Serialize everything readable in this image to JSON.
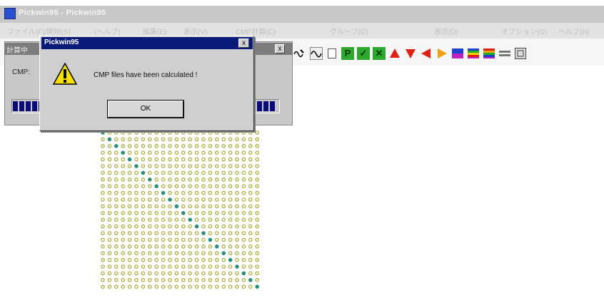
{
  "app": {
    "title": "Pickwin95 - Pickwin95",
    "menu": [
      "ファイル(F)/開始(S)",
      "(ヘルプ)",
      "編集(E)",
      "表示(V)",
      "CMP計算(C)",
      "グループ(G)",
      "表示(D)",
      "オプション(O)",
      "ヘルプ(H)"
    ]
  },
  "progress_window": {
    "title": "計算中",
    "close_label": "x",
    "label": "CMP:",
    "progress_fraction": 1.0
  },
  "dialog": {
    "title": "Pickwin95",
    "close_label": "x",
    "message": "CMP files have been calculated !",
    "ok_label": "OK",
    "icon": "warning-icon"
  },
  "toolbar": {
    "buttons": [
      {
        "name": "wave-cursor-icon",
        "label": ""
      },
      {
        "name": "wave-icon",
        "label": ""
      },
      {
        "name": "page-icon",
        "label": ""
      },
      {
        "name": "p-icon",
        "label": "P"
      },
      {
        "name": "check-icon",
        "label": "✓"
      },
      {
        "name": "cross-icon",
        "label": "✕"
      },
      {
        "name": "triangle-up-icon",
        "label": ""
      },
      {
        "name": "triangle-down-icon",
        "label": ""
      },
      {
        "name": "triangle-left-icon",
        "label": ""
      },
      {
        "name": "triangle-right-icon",
        "label": ""
      },
      {
        "name": "color-bar-blue-icon",
        "label": ""
      },
      {
        "name": "color-bar-multi-icon",
        "label": ""
      },
      {
        "name": "color-bar-rainbow-icon",
        "label": ""
      },
      {
        "name": "grey-bar-icon",
        "label": ""
      },
      {
        "name": "window-icon",
        "label": ""
      }
    ],
    "colors": {
      "green": "#2fa82f",
      "red": "#e02010",
      "orange": "#f0a010",
      "blue": "#2040d0",
      "magenta": "#c020c0"
    }
  },
  "matrix": {
    "rows": 24,
    "cols": 24,
    "dot_color": "#a8a830",
    "diagonal_color": "#2a8f7a"
  }
}
